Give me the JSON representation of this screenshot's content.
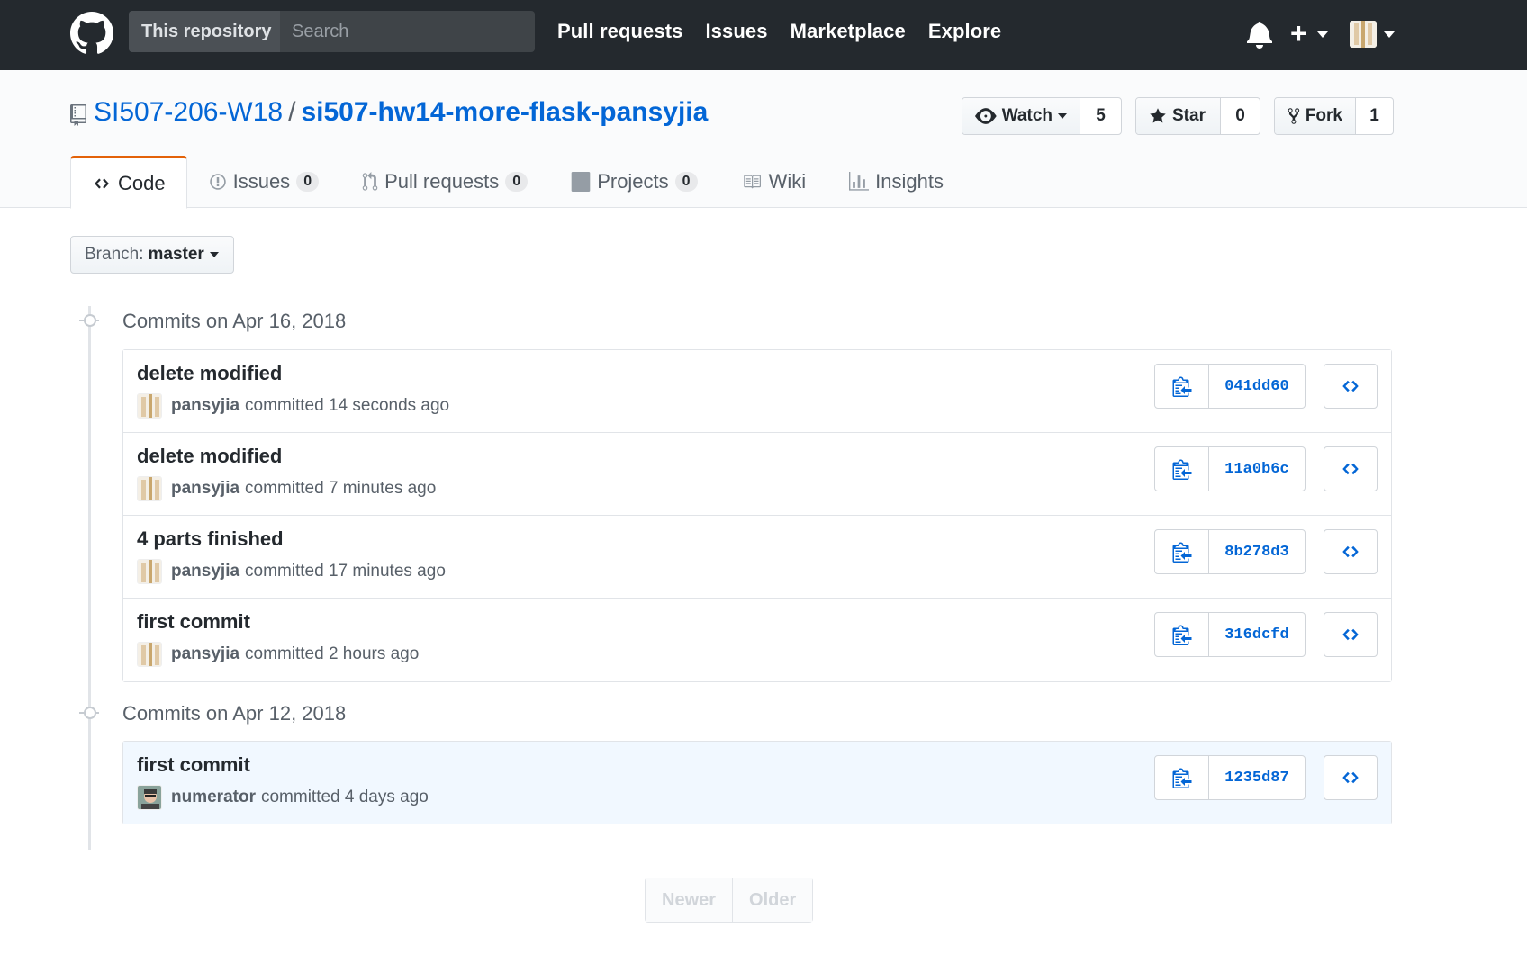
{
  "header": {
    "scope_label": "This repository",
    "search_placeholder": "Search",
    "nav": [
      "Pull requests",
      "Issues",
      "Marketplace",
      "Explore"
    ]
  },
  "repo": {
    "owner": "SI507-206-W18",
    "separator": "/",
    "name": "si507-hw14-more-flask-pansyjia",
    "watch_label": "Watch",
    "watch_count": "5",
    "star_label": "Star",
    "star_count": "0",
    "fork_label": "Fork",
    "fork_count": "1"
  },
  "tabs": [
    {
      "label": "Code",
      "icon": "code-icon"
    },
    {
      "label": "Issues",
      "count": "0",
      "icon": "issue-icon"
    },
    {
      "label": "Pull requests",
      "count": "0",
      "icon": "pull-request-icon"
    },
    {
      "label": "Projects",
      "count": "0",
      "icon": "project-icon"
    },
    {
      "label": "Wiki",
      "icon": "book-icon"
    },
    {
      "label": "Insights",
      "icon": "graph-icon"
    }
  ],
  "branch": {
    "label": "Branch:",
    "value": "master"
  },
  "groups": [
    {
      "title": "Commits on Apr 16, 2018",
      "commits": [
        {
          "message": "delete modified",
          "author": "pansyjia",
          "time": "committed 14 seconds ago",
          "sha": "041dd60"
        },
        {
          "message": "delete modified",
          "author": "pansyjia",
          "time": "committed 7 minutes ago",
          "sha": "11a0b6c"
        },
        {
          "message": "4 parts finished",
          "author": "pansyjia",
          "time": "committed 17 minutes ago",
          "sha": "8b278d3"
        },
        {
          "message": "first commit",
          "author": "pansyjia",
          "time": "committed 2 hours ago",
          "sha": "316dcfd"
        }
      ]
    },
    {
      "title": "Commits on Apr 12, 2018",
      "commits": [
        {
          "message": "first commit",
          "author": "numerator",
          "time": "committed 4 days ago",
          "sha": "1235d87"
        }
      ]
    }
  ],
  "pagination": {
    "newer": "Newer",
    "older": "Older"
  },
  "colors": {
    "header_bg": "#24292e",
    "link": "#0366d6",
    "tab_accent": "#e36209",
    "highlight_row": "#f1f8ff"
  }
}
